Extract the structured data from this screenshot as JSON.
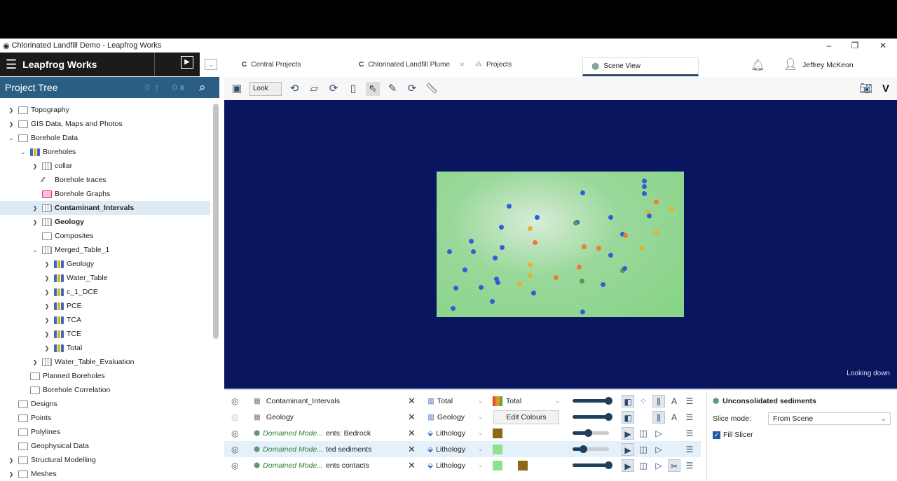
{
  "window": {
    "title": "Chlorinated Landfill Demo - Leapfrog Works",
    "min": "–",
    "max": "❐",
    "close": "✕"
  },
  "app": {
    "name": "Leapfrog Works"
  },
  "tabs": [
    {
      "label": "Central Projects"
    },
    {
      "label": "Chlorinated Landfill Plume",
      "close": "×"
    },
    {
      "label": "Projects"
    },
    {
      "label": "Scene View",
      "active": true
    }
  ],
  "user": {
    "name": "Jeffrey McKeon"
  },
  "tree_header": {
    "title": "Project Tree",
    "count1": "0",
    "count2": "0"
  },
  "toolbar": {
    "mode": "Look"
  },
  "tree": [
    {
      "label": "Topography",
      "level": 0,
      "exp": "›",
      "icon": "folder"
    },
    {
      "label": "GIS Data, Maps and Photos",
      "level": 0,
      "exp": "›",
      "icon": "folder"
    },
    {
      "label": "Borehole Data",
      "level": 0,
      "exp": "⌄",
      "icon": "folder"
    },
    {
      "label": "Boreholes",
      "level": 1,
      "exp": "⌄",
      "icon": "bars"
    },
    {
      "label": "collar",
      "level": 2,
      "exp": "›",
      "icon": "table"
    },
    {
      "label": "Borehole traces",
      "level": 2,
      "exp": "",
      "icon": "traces"
    },
    {
      "label": "Borehole Graphs",
      "level": 2,
      "exp": "",
      "icon": "graph"
    },
    {
      "label": "Contaminant_Intervals",
      "level": 2,
      "exp": "›",
      "icon": "table",
      "bold": true,
      "selected": true
    },
    {
      "label": "Geology",
      "level": 2,
      "exp": "›",
      "icon": "table",
      "bold": true
    },
    {
      "label": "Composites",
      "level": 2,
      "exp": "",
      "icon": "folder"
    },
    {
      "label": "Merged_Table_1",
      "level": 2,
      "exp": "⌄",
      "icon": "table"
    },
    {
      "label": "Geology",
      "level": 3,
      "exp": "›",
      "icon": "bars"
    },
    {
      "label": "Water_Table",
      "level": 3,
      "exp": "›",
      "icon": "bars"
    },
    {
      "label": "c_1_DCE",
      "level": 3,
      "exp": "›",
      "icon": "bars"
    },
    {
      "label": "PCE",
      "level": 3,
      "exp": "›",
      "icon": "bars"
    },
    {
      "label": "TCA",
      "level": 3,
      "exp": "›",
      "icon": "bars"
    },
    {
      "label": "TCE",
      "level": 3,
      "exp": "›",
      "icon": "bars"
    },
    {
      "label": "Total",
      "level": 3,
      "exp": "›",
      "icon": "bars"
    },
    {
      "label": "Water_Table_Evaluation",
      "level": 2,
      "exp": "›",
      "icon": "table"
    },
    {
      "label": "Planned Boreholes",
      "level": 1,
      "exp": "",
      "icon": "folder"
    },
    {
      "label": "Borehole Correlation",
      "level": 1,
      "exp": "",
      "icon": "folder"
    },
    {
      "label": "Designs",
      "level": 0,
      "exp": "",
      "icon": "folder"
    },
    {
      "label": "Points",
      "level": 0,
      "exp": "",
      "icon": "folder"
    },
    {
      "label": "Polylines",
      "level": 0,
      "exp": "",
      "icon": "folder"
    },
    {
      "label": "Geophysical Data",
      "level": 0,
      "exp": "",
      "icon": "folder"
    },
    {
      "label": "Structural Modelling",
      "level": 0,
      "exp": "›",
      "icon": "folder"
    },
    {
      "label": "Meshes",
      "level": 0,
      "exp": "›",
      "icon": "folder"
    }
  ],
  "scene": {
    "status": "Looking down"
  },
  "layers": [
    {
      "name": "Contaminant_Intervals",
      "italic": "",
      "property": "Total",
      "colour_label": "Total",
      "opacity": 100,
      "visible": true
    },
    {
      "name": "Geology",
      "italic": "",
      "property": "Geology",
      "button": "Edit Colours",
      "opacity": 100,
      "visible": false
    },
    {
      "name": "ents: Bedrock",
      "italic": "Domained Mode...",
      "property": "Lithology",
      "swatches": [
        "#8a6a14"
      ],
      "opacity": 45
    },
    {
      "name": "ted sediments",
      "italic": "Domained Mode...",
      "property": "Lithology",
      "swatches": [
        "#8ee28e"
      ],
      "opacity": 30,
      "highlight": true
    },
    {
      "name": "ents contacts",
      "italic": "Domained Mode...",
      "property": "Lithology",
      "swatches": [
        "#8ee28e",
        "#8a6a14"
      ],
      "opacity": 100
    }
  ],
  "properties": {
    "title": "Unconsolidated sediments",
    "slice_label": "Slice mode:",
    "slice_value": "From Scene",
    "fill_slicer": "Fill Slicer",
    "fill_checked": true
  },
  "colors": {
    "scene_bg": "#0a1560",
    "header_blue": "#2a5f83",
    "accent": "#1f3f5c"
  }
}
